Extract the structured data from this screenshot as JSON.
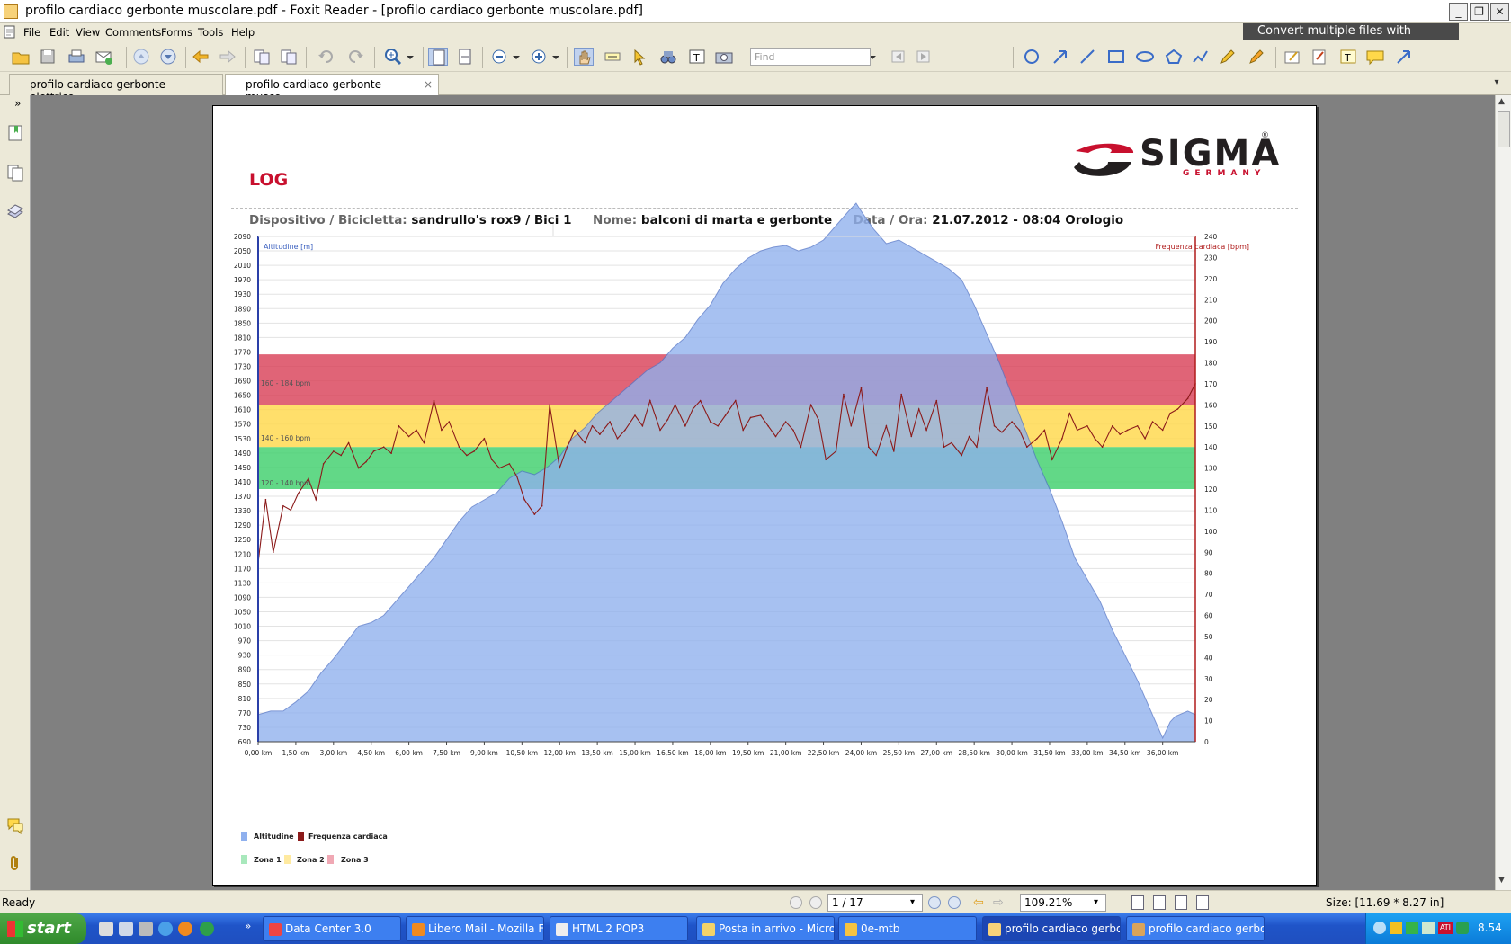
{
  "window": {
    "title": "profilo cardiaco gerbonte muscolare.pdf - Foxit Reader - [profilo cardiaco gerbonte muscolare.pdf]",
    "buttons": [
      "minimize",
      "restore",
      "close"
    ]
  },
  "menu": [
    "File",
    "Edit",
    "View",
    "Comments",
    "Forms",
    "Tools",
    "Help"
  ],
  "banner": "Convert multiple files with Phantom",
  "toolbar": {
    "find_placeholder": "Find"
  },
  "tabs": [
    {
      "label": "profilo cardiaco gerbonte elettrico"
    },
    {
      "label": "profilo cardiaco gerbonte musco...",
      "close": "×"
    }
  ],
  "document": {
    "brand": "SIGMA",
    "brand_sub": "GERMANY",
    "heading": "LOG",
    "info": {
      "device_label": "Dispositivo / Bicicletta:",
      "device_value": "sandrullo's rox9  / Bici 1",
      "name_label": "Nome:",
      "name_value": "balconi di marta e gerbonte",
      "date_label": "Data / Ora:",
      "date_value": "21.07.2012 - 08:04 Orologio"
    },
    "legend": {
      "altitude": "Altitudine",
      "heart_rate": "Frequenza cardiaca",
      "zone1": "Zona 1",
      "zone2": "Zona 2",
      "zone3": "Zona 3"
    },
    "zone_labels": [
      "160 - 184 bpm",
      "140 - 160 bpm",
      "120 - 140 bpm"
    ]
  },
  "chart_data": {
    "type": "area",
    "left_axis_label": "Altitudine [m]",
    "right_axis_label": "Frequenza cardiaca [bpm]",
    "left_ylim": [
      690,
      2090
    ],
    "right_ylim": [
      0,
      240
    ],
    "left_ticks": [
      2090,
      2050,
      2010,
      1970,
      1930,
      1890,
      1850,
      1810,
      1770,
      1730,
      1690,
      1650,
      1610,
      1570,
      1530,
      1490,
      1450,
      1410,
      1370,
      1330,
      1290,
      1250,
      1210,
      1170,
      1130,
      1090,
      1050,
      1010,
      970,
      930,
      890,
      850,
      810,
      770,
      730,
      690
    ],
    "right_ticks": [
      240,
      230,
      220,
      210,
      200,
      190,
      180,
      170,
      160,
      150,
      140,
      130,
      120,
      110,
      100,
      90,
      80,
      70,
      60,
      50,
      40,
      30,
      20,
      10,
      0
    ],
    "x_ticks": [
      "0,00 km",
      "1,50 km",
      "3,00 km",
      "4,50 km",
      "6,00 km",
      "7,50 km",
      "9,00 km",
      "10,50 km",
      "12,00 km",
      "13,50 km",
      "15,00 km",
      "16,50 km",
      "18,00 km",
      "19,50 km",
      "21,00 km",
      "22,50 km",
      "24,00 km",
      "25,50 km",
      "27,00 km",
      "28,50 km",
      "30,00 km",
      "31,50 km",
      "33,00 km",
      "34,50 km",
      "36,00 km"
    ],
    "xlim_km": [
      0,
      37.3
    ],
    "zones_bpm": [
      {
        "name": "Zona 1",
        "from": 120,
        "to": 140,
        "color": "#3fcf6d"
      },
      {
        "name": "Zona 2",
        "from": 140,
        "to": 160,
        "color": "#ffd84a"
      },
      {
        "name": "Zona 3",
        "from": 160,
        "to": 184,
        "color": "#d94259"
      }
    ],
    "series": [
      {
        "name": "Altitudine",
        "color": "#8fb0ee",
        "km": [
          0,
          0.5,
          1.0,
          1.5,
          2.0,
          2.5,
          3.0,
          3.5,
          4.0,
          4.5,
          5.0,
          5.5,
          6.0,
          6.5,
          7.0,
          7.5,
          8.0,
          8.5,
          9.0,
          9.5,
          10.0,
          10.5,
          11.0,
          11.5,
          12.0,
          12.5,
          13.0,
          13.5,
          14.0,
          14.5,
          15.0,
          15.5,
          16.0,
          16.5,
          17.0,
          17.5,
          18.0,
          18.5,
          19.0,
          19.5,
          20.0,
          20.5,
          21.0,
          21.5,
          22.0,
          22.5,
          23.0,
          23.5,
          23.8,
          24.0,
          24.5,
          25.0,
          25.5,
          26.0,
          26.5,
          27.0,
          27.5,
          28.0,
          28.5,
          29.0,
          29.5,
          30.0,
          30.5,
          31.0,
          31.5,
          32.0,
          32.5,
          33.0,
          33.5,
          34.0,
          34.5,
          35.0,
          35.5,
          36.0,
          36.3,
          36.5,
          37.0,
          37.3
        ],
        "values": [
          765,
          775,
          775,
          800,
          830,
          880,
          920,
          965,
          1010,
          1020,
          1040,
          1080,
          1120,
          1160,
          1200,
          1250,
          1300,
          1340,
          1360,
          1380,
          1420,
          1440,
          1430,
          1450,
          1480,
          1530,
          1560,
          1600,
          1630,
          1660,
          1690,
          1720,
          1740,
          1780,
          1810,
          1860,
          1900,
          1960,
          2000,
          2030,
          2050,
          2060,
          2065,
          2050,
          2060,
          2080,
          2120,
          2160,
          2182,
          2160,
          2110,
          2070,
          2080,
          2060,
          2040,
          2020,
          2000,
          1970,
          1900,
          1820,
          1740,
          1650,
          1560,
          1470,
          1390,
          1300,
          1200,
          1140,
          1080,
          1000,
          930,
          860,
          780,
          700,
          745,
          760,
          775,
          765
        ]
      },
      {
        "name": "Frequenza cardiaca",
        "color": "#8b1a1a",
        "km": [
          0,
          0.3,
          0.6,
          1.0,
          1.3,
          1.6,
          2.0,
          2.3,
          2.6,
          3.0,
          3.3,
          3.6,
          4.0,
          4.3,
          4.6,
          5.0,
          5.3,
          5.6,
          6.0,
          6.3,
          6.6,
          7.0,
          7.3,
          7.6,
          8.0,
          8.3,
          8.6,
          9.0,
          9.3,
          9.6,
          10.0,
          10.3,
          10.6,
          11.0,
          11.3,
          11.6,
          12.0,
          12.3,
          12.6,
          13.0,
          13.3,
          13.6,
          14.0,
          14.3,
          14.6,
          15.0,
          15.3,
          15.6,
          16.0,
          16.3,
          16.6,
          17.0,
          17.3,
          17.6,
          18.0,
          18.3,
          18.6,
          19.0,
          19.3,
          19.6,
          20.0,
          20.3,
          20.6,
          21.0,
          21.3,
          21.6,
          22.0,
          22.3,
          22.6,
          23.0,
          23.3,
          23.6,
          24.0,
          24.3,
          24.6,
          25.0,
          25.3,
          25.6,
          26.0,
          26.3,
          26.6,
          27.0,
          27.3,
          27.6,
          28.0,
          28.3,
          28.6,
          29.0,
          29.3,
          29.6,
          30.0,
          30.3,
          30.6,
          31.0,
          31.3,
          31.6,
          32.0,
          32.3,
          32.6,
          33.0,
          33.3,
          33.6,
          34.0,
          34.3,
          34.6,
          35.0,
          35.3,
          35.6,
          36.0,
          36.3,
          36.6,
          37.0,
          37.3
        ],
        "values": [
          85,
          115,
          90,
          112,
          110,
          118,
          125,
          115,
          132,
          138,
          136,
          142,
          130,
          133,
          138,
          140,
          137,
          150,
          145,
          148,
          142,
          162,
          148,
          152,
          140,
          136,
          138,
          144,
          134,
          130,
          132,
          126,
          115,
          108,
          112,
          160,
          130,
          140,
          148,
          142,
          150,
          146,
          152,
          144,
          148,
          155,
          150,
          162,
          148,
          153,
          160,
          150,
          158,
          162,
          152,
          150,
          155,
          162,
          148,
          154,
          155,
          150,
          145,
          152,
          148,
          140,
          160,
          153,
          134,
          138,
          165,
          150,
          168,
          140,
          136,
          150,
          138,
          165,
          145,
          158,
          148,
          162,
          140,
          142,
          136,
          145,
          140,
          168,
          150,
          147,
          152,
          148,
          140,
          144,
          148,
          134,
          144,
          156,
          148,
          150,
          144,
          140,
          150,
          146,
          148,
          150,
          144,
          152,
          148,
          156,
          158,
          163,
          170,
          158
        ]
      }
    ]
  }
}
